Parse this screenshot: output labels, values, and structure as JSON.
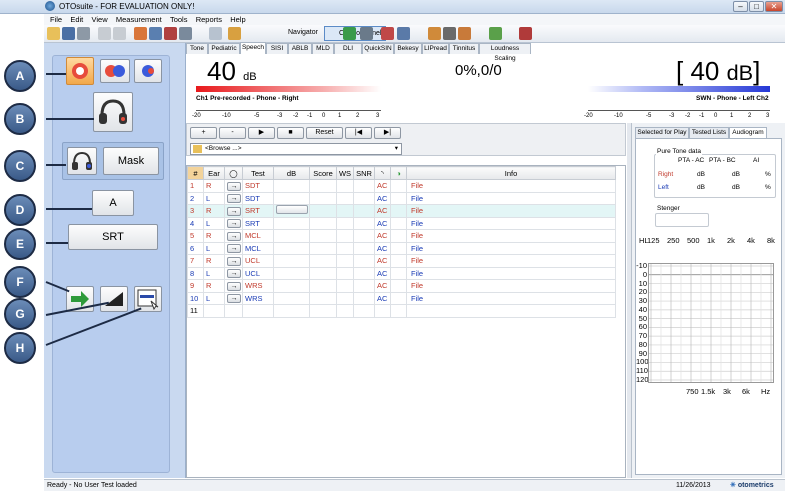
{
  "window": {
    "title": "OTOsuite - FOR EVALUATION ONLY!",
    "minimize": "–",
    "maximize": "□",
    "close": "✕"
  },
  "menu": [
    "File",
    "Edit",
    "View",
    "Measurement",
    "Tools",
    "Reports",
    "Help"
  ],
  "toolbar": {
    "navigator_label": "Navigator",
    "control_panel_label": "Control Panel"
  },
  "tabs": [
    "Tone",
    "Pediatric",
    "Speech",
    "SISI",
    "ABLB",
    "MLD",
    "DLI",
    "QuickSIN",
    "Bekesy",
    "LIPread",
    "Tinnitus",
    "Loudness Scaling"
  ],
  "active_tab": "Speech",
  "callouts": [
    "A",
    "B",
    "C",
    "D",
    "E",
    "F",
    "G",
    "H"
  ],
  "left_panel": {
    "mask_label": "Mask",
    "a_label": "A",
    "srt_label": "SRT"
  },
  "meters": {
    "left_value": "40",
    "left_unit": "dB",
    "score": "0%,0/0",
    "right_value": "40",
    "right_unit": "dB",
    "left_channel": "Ch1  Pre-recorded - Phone - Right",
    "right_channel": "SWN - Phone - Left  Ch2",
    "scale": [
      "-20",
      "-10",
      "-5",
      "-3",
      "-2",
      "-1",
      "0",
      "1",
      "2",
      "3"
    ],
    "left_color": "#e8191c",
    "right_color": "#2538d6"
  },
  "controls": {
    "plus": "+",
    "minus": "-",
    "play": "▶",
    "stop": "■",
    "reset": "Reset",
    "prev": "|◀",
    "next": "▶|",
    "browse": "<Browse ...>"
  },
  "grid": {
    "headers": [
      "#",
      "Ear",
      "",
      "Test",
      "dB",
      "Score",
      "WS",
      "SNR",
      "",
      "",
      "Info"
    ],
    "rows": [
      {
        "n": "1",
        "ear": "R",
        "test": "SDT",
        "mask": "AC",
        "info": "File",
        "sel": false
      },
      {
        "n": "2",
        "ear": "L",
        "test": "SDT",
        "mask": "AC",
        "info": "File",
        "sel": false
      },
      {
        "n": "3",
        "ear": "R",
        "test": "SRT",
        "mask": "AC",
        "info": "File",
        "sel": true
      },
      {
        "n": "4",
        "ear": "L",
        "test": "SRT",
        "mask": "AC",
        "info": "File",
        "sel": false
      },
      {
        "n": "5",
        "ear": "R",
        "test": "MCL",
        "mask": "AC",
        "info": "File",
        "sel": false
      },
      {
        "n": "6",
        "ear": "L",
        "test": "MCL",
        "mask": "AC",
        "info": "File",
        "sel": false
      },
      {
        "n": "7",
        "ear": "R",
        "test": "UCL",
        "mask": "AC",
        "info": "File",
        "sel": false
      },
      {
        "n": "8",
        "ear": "L",
        "test": "UCL",
        "mask": "AC",
        "info": "File",
        "sel": false
      },
      {
        "n": "9",
        "ear": "R",
        "test": "WRS",
        "mask": "AC",
        "info": "File",
        "sel": false
      },
      {
        "n": "10",
        "ear": "L",
        "test": "WRS",
        "mask": "AC",
        "info": "File",
        "sel": false
      },
      {
        "n": "11",
        "ear": "",
        "test": "",
        "mask": "",
        "info": "",
        "sel": false
      }
    ]
  },
  "right_panel": {
    "tabs": [
      "Selected for Play",
      "Tested Lists",
      "Audiogram"
    ],
    "pure_tone_title": "Pure Tone data",
    "col_ac": "PTA - AC",
    "col_bc": "PTA - BC",
    "col_ai": "AI",
    "right_label": "Right",
    "left_label": "Left",
    "db": "dB",
    "pct": "%",
    "stenger": "Stenger",
    "hl": "HL",
    "freq_top": [
      "125",
      "250",
      "500",
      "1k",
      "2k",
      "4k",
      "8k"
    ],
    "freq_bottom": [
      "750",
      "1.5k",
      "3k",
      "6k",
      "Hz"
    ],
    "levels": [
      "-10",
      "0",
      "10",
      "20",
      "30",
      "40",
      "50",
      "60",
      "70",
      "80",
      "90",
      "100",
      "110",
      "120"
    ]
  },
  "status": {
    "left": "Ready - No User Test loaded",
    "date": "11/26/2013",
    "brand": "otometrics"
  }
}
